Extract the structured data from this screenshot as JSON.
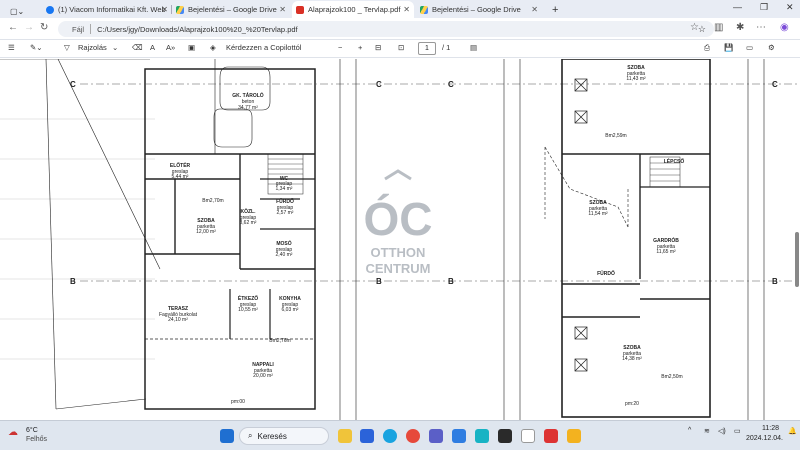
{
  "tabs": [
    {
      "label": "(1) Viacom Informatikai Kft. Web"
    },
    {
      "label": "Bejelentési – Google Drive"
    },
    {
      "label": "Alaprajzok100 _ Tervlap.pdf"
    },
    {
      "label": "Bejelentési – Google Drive"
    }
  ],
  "address": {
    "prefix": "Fájl",
    "url": "C:/Users/jgy/Downloads/Alaprajzok100%20_%20Tervlap.pdf"
  },
  "pdf_toolbar": {
    "draw_label": "Rajzolás",
    "ask_label": "Kérdezzen a Copilottól",
    "page_current": "1",
    "page_total": "/ 1"
  },
  "drawing": {
    "logo_top": "ÓC",
    "logo_line1": "OTTHON",
    "logo_line2": "CENTRUM",
    "section_c": "C",
    "section_b": "B",
    "left_rooms": [
      {
        "name": "GK. TÁROLÓ",
        "sub": "beton",
        "area": "34,77 m²"
      },
      {
        "name": "ELŐTÉR",
        "sub": "greslap",
        "area": "5,44 m²"
      },
      {
        "name": "WC",
        "sub": "greslap",
        "area": "1,34 m²"
      },
      {
        "name": "FÜRDŐ",
        "sub": "greslap",
        "area": "2,57 m²"
      },
      {
        "name": "KÖZL.",
        "sub": "greslap",
        "area": "8,62 m²"
      },
      {
        "name": "SZOBA",
        "sub": "parketta",
        "area": "12,00 m²"
      },
      {
        "name": "MOSÓ",
        "sub": "greslap",
        "area": "2,40 m²"
      },
      {
        "name": "TERASZ",
        "sub": "Fagyálló burkolat",
        "area": "24,10 m²"
      },
      {
        "name": "ÉTKEZŐ",
        "sub": "greslap",
        "area": "10,55 m²"
      },
      {
        "name": "KONYHA",
        "sub": "greslap",
        "area": "6,03 m²"
      },
      {
        "name": "NAPPALI",
        "sub": "parketta",
        "area": "20,00 m²"
      }
    ],
    "right_rooms": [
      {
        "name": "SZOBA",
        "sub": "parketta",
        "area": "11,43 m²"
      },
      {
        "name": "LÉPCSŐ",
        "sub": "",
        "area": ""
      },
      {
        "name": "SZOBA",
        "sub": "parketta",
        "area": "11,54 m²"
      },
      {
        "name": "GARDRÓB",
        "sub": "parketta",
        "area": "11,65 m²"
      },
      {
        "name": "FÜRDŐ",
        "sub": "",
        "area": ""
      },
      {
        "name": "SZOBA",
        "sub": "parketta",
        "area": "14,38 m²"
      }
    ],
    "notes": [
      "Bm2,70m",
      "Bm2,76m",
      "Bm2,59m",
      "Bm2,50m",
      "pm:00",
      "pm:20"
    ]
  },
  "taskbar": {
    "weather_temp": "6°C",
    "weather_text": "Felhős",
    "search_label": "Keresés",
    "time": "11:28",
    "date": "2024.12.04."
  },
  "colors": {
    "accent": "#0b57d0",
    "pdf_red": "#d93025"
  }
}
